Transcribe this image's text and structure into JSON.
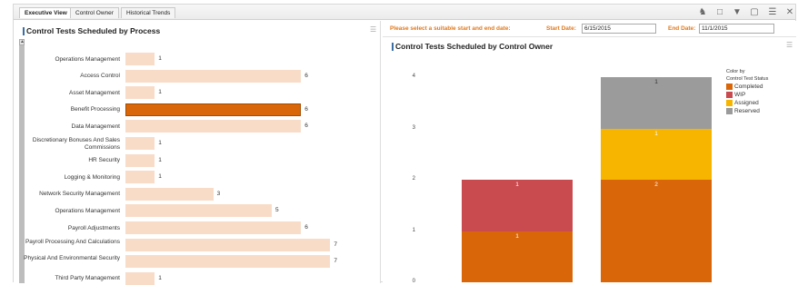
{
  "tabs": [
    {
      "label": "Executive View",
      "active": true
    },
    {
      "label": "Control Owner",
      "active": false
    },
    {
      "label": "Historical Trends",
      "active": false
    }
  ],
  "toolbar_icons": [
    "user-icon",
    "bookmark-icon",
    "filter-icon",
    "export-icon",
    "menu-icon",
    "close-icon"
  ],
  "left_panel": {
    "title": "Control Tests Scheduled by Process",
    "menu_glyph": "☰"
  },
  "right_panel": {
    "prompt": "Please select a suitable start and end date:",
    "start_label": "Start Date:",
    "start_value": "6/15/2015",
    "end_label": "End Date:",
    "end_value": "11/1/2015",
    "title": "Control Tests Scheduled by Control Owner",
    "menu_glyph": "☰"
  },
  "colors": {
    "bar": "#f8dcc8",
    "bar_selected": "#d9670a",
    "completed": "#d9670a",
    "wip": "#c94a4f",
    "assigned": "#f7b500",
    "reserved": "#9b9b9b"
  },
  "chart_data": [
    {
      "type": "bar",
      "orientation": "horizontal",
      "title": "Control Tests Scheduled by Process",
      "categories": [
        "Operations Management",
        "Access Control",
        "Asset Management",
        "Benefit Processing",
        "Data Management",
        "Discretionary Bonuses And Sales Commissions",
        "HR Security",
        "Logging & Monitoring",
        "Network Security Management",
        "Operations Management",
        "Payroll Adjustments",
        "Payroll Processing And Calculations",
        "Physical And Environmental Security",
        "Third Party Management"
      ],
      "values": [
        1,
        6,
        1,
        6,
        6,
        1,
        1,
        1,
        3,
        5,
        6,
        7,
        7,
        1
      ],
      "highlighted": "Benefit Processing",
      "xlim": [
        0,
        7
      ]
    },
    {
      "type": "bar",
      "stacked": true,
      "title": "Control Tests Scheduled by Control Owner",
      "categories": [
        "",
        ""
      ],
      "ylim": [
        0,
        4
      ],
      "yticks": [
        0,
        1,
        2,
        3,
        4
      ],
      "legend_title_1": "Color by",
      "legend_title_2": "Control Test Status",
      "legend_position": "top-right",
      "series": [
        {
          "name": "Completed",
          "values": [
            1,
            2
          ]
        },
        {
          "name": "WIP",
          "values": [
            1,
            0
          ]
        },
        {
          "name": "Assigned",
          "values": [
            0,
            1
          ]
        },
        {
          "name": "Reserved",
          "values": [
            0,
            1
          ]
        }
      ]
    }
  ]
}
